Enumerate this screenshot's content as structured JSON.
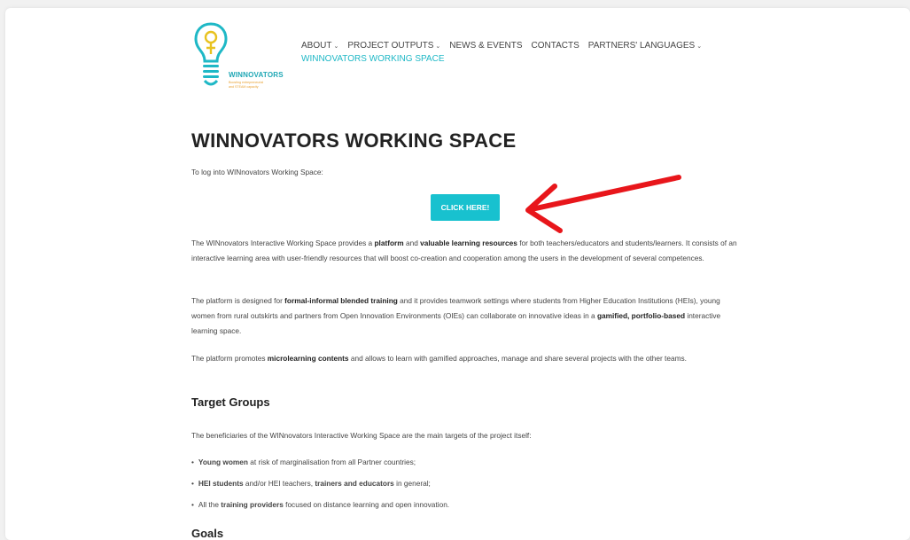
{
  "logo": {
    "name": "WINNOVATORS",
    "tagline_line1": "Boosting entrepreneurial",
    "tagline_line2": "and STEAM capacity",
    "bulb_color": "#1fb8c6",
    "symbol_color": "#e8c21f"
  },
  "nav": {
    "items": [
      {
        "label": "ABOUT",
        "has_dropdown": true
      },
      {
        "label": "PROJECT OUTPUTS",
        "has_dropdown": true
      },
      {
        "label": "NEWS & EVENTS",
        "has_dropdown": false
      },
      {
        "label": "CONTACTS",
        "has_dropdown": false
      },
      {
        "label": "PARTNERS' LANGUAGES",
        "has_dropdown": true
      }
    ],
    "dropdown_glyph": "⌄",
    "active": "WINNOVATORS WORKING SPACE",
    "active_color": "#1fb8c6"
  },
  "page": {
    "title": "WINNOVATORS WORKING SPACE",
    "login_intro": "To log into WINnovators Working Space:",
    "cta_label": "CLICK HERE!",
    "cta_color": "#18c1cf",
    "annotation_arrow_color": "#e8161b",
    "p1": {
      "a": "The WINnovators Interactive Working Space provides a ",
      "b1": "platform",
      "c": " and ",
      "b2": "valuable learning resources",
      "d": " for both teachers/educators and students/learners. It consists of an interactive learning area with user-friendly resources that will boost co-creation and cooperation among the users in the development of several competences."
    },
    "p2": {
      "a": "The platform is designed for ",
      "b1": "formal-informal blended training",
      "c": " and it provides teamwork settings where students from Higher Education Institutions (HEIs), young women from rural outskirts and partners from Open Innovation Environments (OIEs) can collaborate on innovative ideas in a ",
      "b2": "gamified, portfolio-based",
      "d": " interactive learning space."
    },
    "p3": {
      "a": "The platform promotes ",
      "b1": "microlearning contents",
      "c": " and allows to learn with gamified approaches, manage and share several projects with the other teams."
    },
    "target_heading": "Target Groups",
    "target_intro": "The beneficiaries of the WINnovators Interactive Working Space are the main targets of the project itself:",
    "targets": [
      {
        "b1": "Young women",
        "t1": " at risk of marginalisation from all Partner countries;",
        "b2": "",
        "t2": ""
      },
      {
        "b1": "HEI students",
        "t1": " and/or HEI teachers, ",
        "b2": "trainers and educators",
        "t2": " in general;"
      },
      {
        "b1": "",
        "t1": "All the ",
        "b2": "training providers",
        "t2": " focused on distance learning and open innovation."
      }
    ],
    "goals_heading": "Goals"
  }
}
